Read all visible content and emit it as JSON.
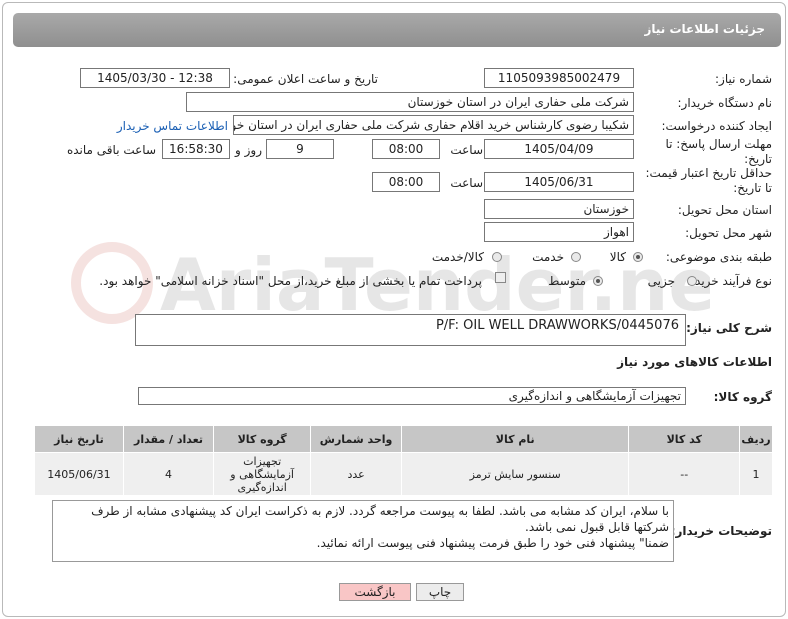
{
  "header": {
    "title": "جزئیات اطلاعات نیاز"
  },
  "form": {
    "need_number_label": "شماره نیاز:",
    "need_number": "1105093985002479",
    "announce_label": "تاریخ و ساعت اعلان عمومی:",
    "announce_value": "1405/03/30 - 12:38",
    "buyer_label": "نام دستگاه خریدار:",
    "buyer_value": "شرکت ملی حفاری ایران در استان خوزستان",
    "creator_label": "ایجاد کننده درخواست:",
    "creator_value": "شکیبا رضوی کارشناس خرید اقلام حفاری شرکت ملی حفاری ایران در استان خو",
    "contact_link": "اطلاعات تماس خریدار",
    "deadline_label": "مهلت ارسال پاسخ: تا تاریخ:",
    "deadline_date": "1405/04/09",
    "time_label": "ساعت",
    "deadline_time": "08:00",
    "days_value": "9",
    "days_label": "روز و",
    "remaining_time": "16:58:30",
    "remaining_label": "ساعت باقی مانده",
    "validity_label": "حداقل تاریخ اعتبار قیمت: تا تاریخ:",
    "validity_date": "1405/06/31",
    "validity_time": "08:00",
    "province_label": "استان محل تحویل:",
    "province_value": "خوزستان",
    "city_label": "شهر محل تحویل:",
    "city_value": "اهواز",
    "category_label": "طبقه بندی موضوعی:",
    "category_options": [
      "کالا",
      "خدمت",
      "کالا/خدمت"
    ],
    "category_selected": "کالا",
    "process_label": "نوع فرآیند خرید :",
    "process_options": [
      "جزیی",
      "متوسط"
    ],
    "process_selected": "متوسط",
    "payment_note": "پرداخت تمام یا بخشی از مبلغ خرید،از محل \"اسناد خزانه اسلامی\" خواهد بود."
  },
  "description": {
    "label": "شرح کلی نیاز:",
    "value": "P/F: OIL WELL DRAWWORKS/0445076"
  },
  "goods": {
    "section_title": "اطلاعات کالاهای مورد نیاز",
    "group_label": "گروه کالا:",
    "group_value": "تجهیزات آزمایشگاهی و اندازه‌گیری",
    "table": {
      "headers": [
        "ردیف",
        "کد کالا",
        "نام کالا",
        "واحد شمارش",
        "گروه کالا",
        "تعداد / مقدار",
        "تاریخ نیاز"
      ],
      "rows": [
        [
          "1",
          "--",
          "سنسور سایش ترمز",
          "عدد",
          "تجهیزات آزمایشگاهی و اندازه‌گیری",
          "4",
          "1405/06/31"
        ]
      ]
    }
  },
  "buyer_notes": {
    "label": "توضیحات خریدار:",
    "line1": "با سلام، ایران کد مشابه می باشد. لطفا به پیوست مراجعه گردد. لازم به ذکراست ایران کد پیشنهادی مشابه از طرف",
    "line2": "شرکتها قابل قبول نمی باشد.",
    "line3": "ضمنا\" پیشنهاد فنی خود را طبق فرمت پیشنهاد فنی پیوست ارائه نمائید."
  },
  "buttons": {
    "print": "چاپ",
    "back": "بازگشت"
  },
  "colors": {
    "header": "#999999",
    "back_button": "#f9c6c6",
    "print_button": "#ececec",
    "link": "#1a5fb4"
  },
  "watermark": {
    "text": "AriaTender.net"
  }
}
